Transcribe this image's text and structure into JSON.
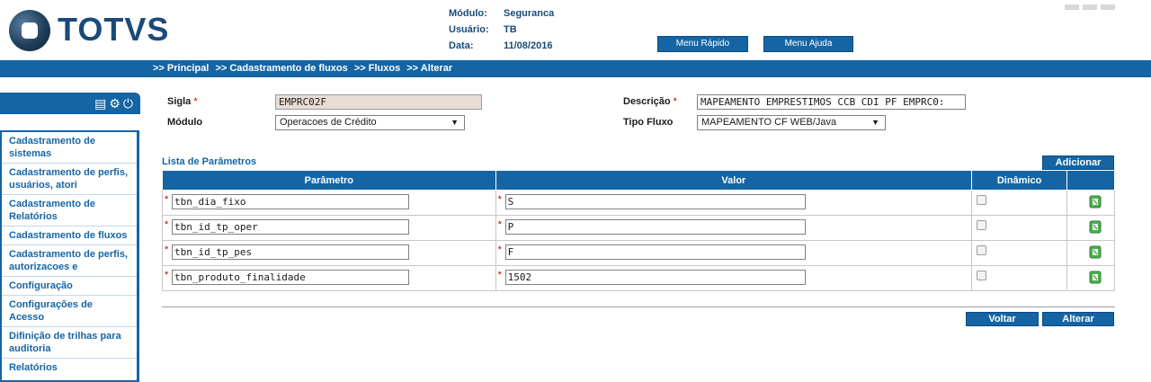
{
  "header": {
    "logo_text": "TOTVS",
    "modulo_label": "Módulo:",
    "modulo_value": "Seguranca",
    "usuario_label": "Usuário:",
    "usuario_value": "TB",
    "data_label": "Data:",
    "data_value": "11/08/2016",
    "menu_rapido": "Menu Rápido",
    "menu_ajuda": "Menu Ajuda"
  },
  "breadcrumb": [
    ">> Principal",
    ">> Cadastramento de fluxos",
    ">> Fluxos",
    ">> Alterar"
  ],
  "sidebar": {
    "icons": [
      "calculator-icon",
      "gear-icon",
      "power-icon"
    ],
    "items": [
      "Cadastramento de sistemas",
      "Cadastramento de perfis, usuários, atori",
      "Cadastramento de Relatórios",
      "Cadastramento de fluxos",
      "Cadastramento de perfis, autorizacoes e",
      "Configuração",
      "Configurações de Acesso",
      "Difinição de trilhas para auditoria",
      "Relatórios"
    ]
  },
  "form": {
    "sigla_label": "Sigla",
    "sigla_value": "EMPRC02F",
    "descricao_label": "Descrição",
    "descricao_value": "MAPEAMENTO EMPRESTIMOS CCB CDI PF EMPRC0:",
    "modulo_label": "Módulo",
    "modulo_value": "Operacoes de Crédito",
    "tipo_fluxo_label": "Tipo Fluxo",
    "tipo_fluxo_value": "MAPEAMENTO CF WEB/Java",
    "required_mark": "*"
  },
  "params": {
    "title": "Lista de Parâmetros",
    "add_label": "Adicionar",
    "columns": [
      "Parâmetro",
      "Valor",
      "Dinâmico",
      ""
    ],
    "rows": [
      {
        "param": "tbn_dia_fixo",
        "valor": "S",
        "dinamico": false
      },
      {
        "param": "tbn_id_tp_oper",
        "valor": "P",
        "dinamico": false
      },
      {
        "param": "tbn_id_tp_pes",
        "valor": "F",
        "dinamico": false
      },
      {
        "param": "tbn_produto_finalidade",
        "valor": "1502",
        "dinamico": false
      }
    ]
  },
  "actions": {
    "voltar": "Voltar",
    "alterar": "Alterar"
  },
  "colors": {
    "primary": "#1565a5",
    "required": "#c00000"
  }
}
